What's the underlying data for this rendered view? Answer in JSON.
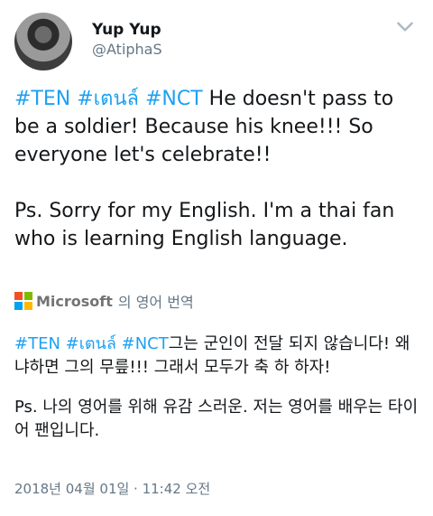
{
  "author": {
    "display_name": "Yup Yup",
    "handle": "@AtiphaS"
  },
  "tweet": {
    "line1_tags": "#TEN #เตนล์ #NCT",
    "line1_text": " He doesn't pass to be a soldier! Because his knee!!! So everyone let's celebrate!!",
    "para2": "Ps. Sorry for my English.  I'm a thai fan who is learning English language."
  },
  "translation_bar": {
    "brand": "Microsoft",
    "label": "의 영어 번역"
  },
  "translation": {
    "tags": "#TEN #เตนล์ #NCT",
    "text1": "그는 군인이 전달 되지 않습니다! 왜냐하면 그의 무릎!!! 그래서 모두가 축 하 하자!",
    "text2": "Ps. 나의 영어를 위해 유감 스러운.  저는 영어를 배우는 타이어 팬입니다."
  },
  "timestamp": "2018년 04월 01일 · 11:42 오전",
  "colors": {
    "link": "#1da1f2",
    "secondary_text": "#657786",
    "ms_red": "#f25022",
    "ms_green": "#7fba00",
    "ms_blue": "#00a4ef",
    "ms_yellow": "#ffb900"
  },
  "icons": {
    "menu": "chevron-down-icon",
    "translator": "microsoft-logo"
  }
}
